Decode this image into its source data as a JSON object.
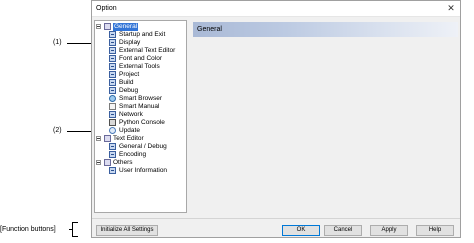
{
  "callouts": {
    "tree_label": "(1)",
    "panel_label": "(2)",
    "buttons_label": "[Function buttons]"
  },
  "window": {
    "title": "Option",
    "close_glyph": "✕"
  },
  "tree": {
    "general": {
      "label": "General",
      "children": [
        "Startup and Exit",
        "Display",
        "External Text Editor",
        "Font and Color",
        "External Tools",
        "Project",
        "Build",
        "Debug",
        "Smart Browser",
        "Smart Manual",
        "Network",
        "Python Console",
        "Update"
      ]
    },
    "text_editor": {
      "label": "Text Editor",
      "children": [
        "General / Debug",
        "Encoding"
      ]
    },
    "others": {
      "label": "Others",
      "children": [
        "User Information"
      ]
    }
  },
  "panel": {
    "title": "General"
  },
  "buttons": {
    "initialize": "Initialize All Settings",
    "ok": "OK",
    "cancel": "Cancel",
    "apply": "Apply",
    "help": "Help"
  },
  "colors": {
    "selection": "#3375d7",
    "header_gradient_start": "#a9b9d6",
    "default_button_border": "#0078d7"
  }
}
